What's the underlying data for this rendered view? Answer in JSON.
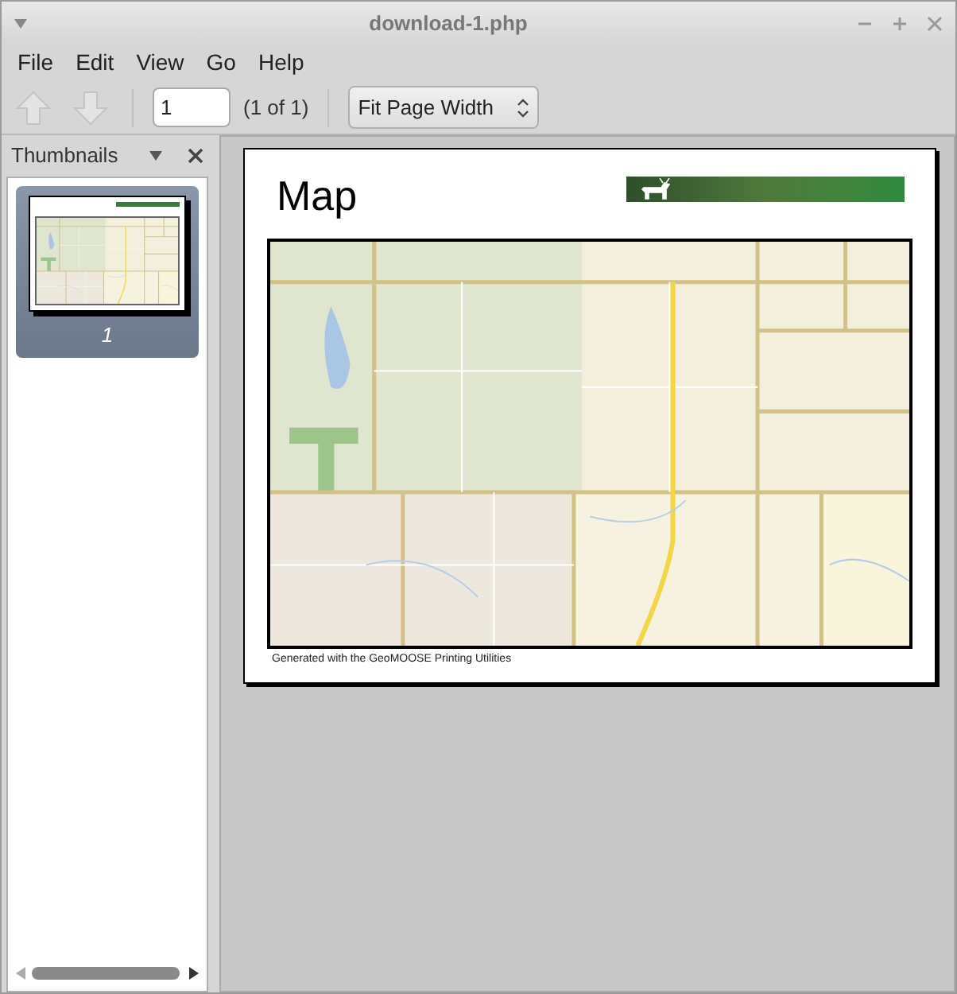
{
  "window": {
    "title": "download-1.php"
  },
  "menu": [
    "File",
    "Edit",
    "View",
    "Go",
    "Help"
  ],
  "toolbar": {
    "previous_disabled": true,
    "next_disabled": true,
    "page_value": "1",
    "page_count": "(1 of 1)",
    "zoom": "Fit Page Width"
  },
  "sidebar": {
    "title": "Thumbnails",
    "thumbnails": [
      {
        "label": "1",
        "selected": true
      }
    ]
  },
  "document": {
    "title": "Map",
    "footer": "Generated with the GeoMOOSE Printing Utilities"
  }
}
